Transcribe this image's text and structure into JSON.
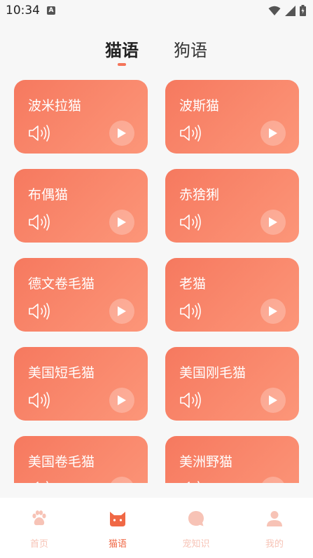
{
  "status_bar": {
    "time": "10:34",
    "indicator": "A"
  },
  "tabs": [
    {
      "label": "猫语",
      "active": true
    },
    {
      "label": "狗语",
      "active": false
    }
  ],
  "cards": [
    {
      "name": "波米拉猫"
    },
    {
      "name": "波斯猫"
    },
    {
      "name": "布偶猫"
    },
    {
      "name": "赤猞猁"
    },
    {
      "name": "德文卷毛猫"
    },
    {
      "name": "老猫"
    },
    {
      "name": "美国短毛猫"
    },
    {
      "name": "美国刚毛猫"
    },
    {
      "name": "美国卷毛猫"
    },
    {
      "name": "美洲野猫"
    }
  ],
  "bottom_nav": [
    {
      "label": "首页",
      "icon": "paw-icon",
      "active": false
    },
    {
      "label": "猫语",
      "icon": "cat-face-icon",
      "active": true
    },
    {
      "label": "宠知识",
      "icon": "chat-bubble-icon",
      "active": false
    },
    {
      "label": "我的",
      "icon": "person-icon",
      "active": false
    }
  ],
  "colors": {
    "accent": "#f06845",
    "card_start": "#f6795f",
    "card_end": "#fc9679",
    "nav_inactive": "#f7c3b6",
    "background": "#f7f7f7"
  }
}
